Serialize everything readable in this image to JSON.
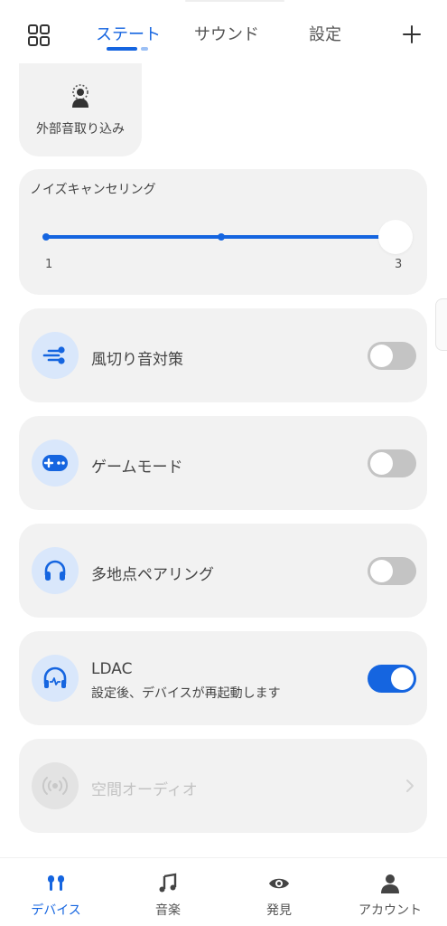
{
  "header": {
    "tabs": [
      {
        "label": "ステート",
        "active": true
      },
      {
        "label": "サウンド",
        "active": false
      },
      {
        "label": "設定",
        "active": false
      }
    ]
  },
  "ambient": {
    "label": "外部音取り込み",
    "icon": "ambient-sound-person-icon"
  },
  "noise_cancel": {
    "title": "ノイズキャンセリング",
    "min_label": "1",
    "max_label": "3",
    "level": 3,
    "max_level": 3
  },
  "features": [
    {
      "label": "風切り音対策",
      "icon": "wind-icon",
      "enabled": false
    },
    {
      "label": "ゲームモード",
      "icon": "gamepad-icon",
      "enabled": false
    },
    {
      "label": "多地点ペアリング",
      "icon": "headphones-icon",
      "enabled": false
    },
    {
      "label": "LDAC",
      "sub": "設定後、デバイスが再起動します",
      "icon": "hires-headphones-icon",
      "enabled": true
    }
  ],
  "spatial": {
    "label": "空間オーディオ",
    "icon": "spatial-audio-icon",
    "disabled": true
  },
  "bottom_nav": [
    {
      "label": "デバイス",
      "icon": "earbuds-icon",
      "active": true
    },
    {
      "label": "音楽",
      "icon": "music-note-icon",
      "active": false
    },
    {
      "label": "発見",
      "icon": "eye-icon",
      "active": false
    },
    {
      "label": "アカウント",
      "icon": "person-icon",
      "active": false
    }
  ],
  "colors": {
    "accent": "#1565e0",
    "card": "#f2f2f2",
    "icon_bg": "#d9e7fb",
    "toggle_off": "#c4c4c4"
  }
}
